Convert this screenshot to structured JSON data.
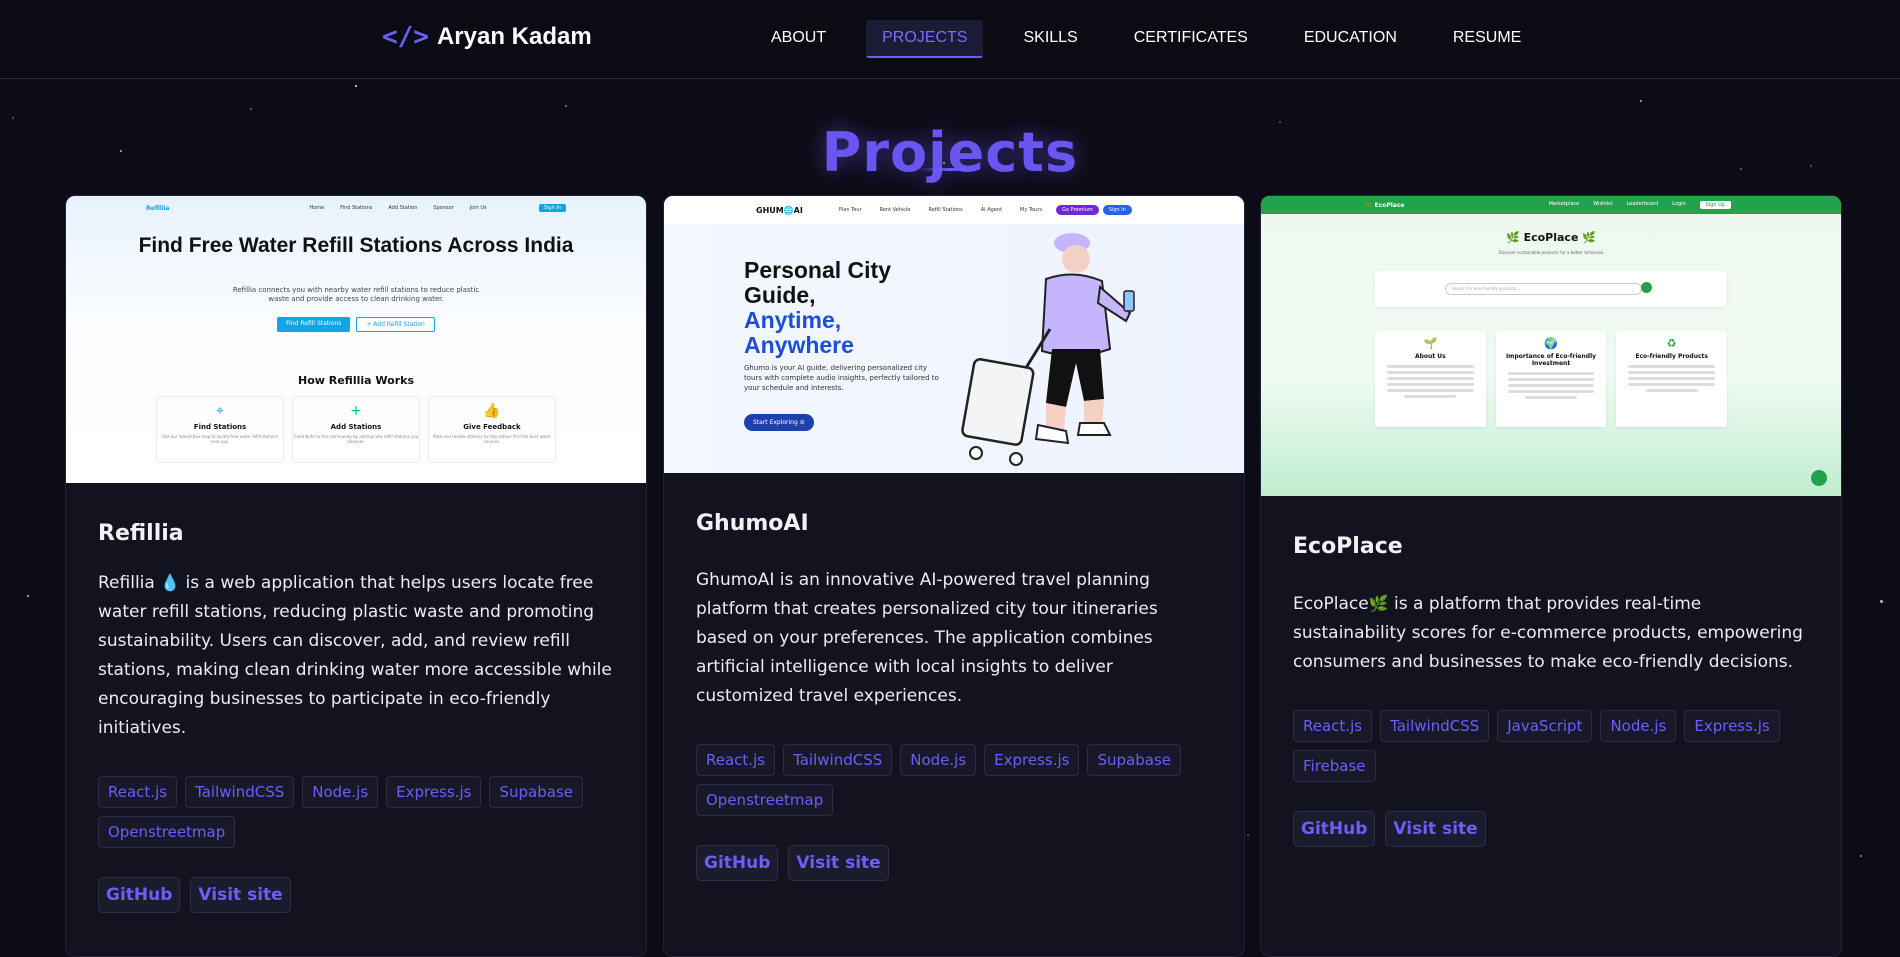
{
  "nav": {
    "logo_icon": "</>",
    "logo_text": "Aryan Kadam",
    "links": [
      "ABOUT",
      "PROJECTS",
      "SKILLS",
      "CERTIFICATES",
      "EDUCATION",
      "RESUME"
    ],
    "active": "PROJECTS"
  },
  "section": {
    "title": "Projects"
  },
  "projects": [
    {
      "title": "Refillia",
      "desc_lead": "Refillia",
      "desc_emoji": "💧",
      "desc_rest": " is a web application that helps users locate free water refill stations, reducing plastic waste and promoting sustainability. Users can discover, add, and review refill stations, making clean drinking water more accessible while encouraging businesses to participate in eco-friendly initiatives.",
      "tags": [
        "React.js",
        "TailwindCSS",
        "Node.js",
        "Express.js",
        "Supabase",
        "Openstreetmap"
      ],
      "links": [
        "GitHub",
        "Visit site"
      ],
      "screenshot": {
        "logo": "Refillia",
        "nav_items": [
          "Home",
          "Find Stations",
          "Add Station",
          "Sponsor",
          "Join Us"
        ],
        "nav_button": "Sign In",
        "heading": "Find Free Water Refill Stations Across India",
        "text": "Refillia connects you with nearby water refill stations to reduce plastic waste and provide access to clean drinking water.",
        "btn_primary": "Find Refill Stations",
        "btn_secondary": "+ Add Refill Station",
        "how_title": "How Refillia Works",
        "features": [
          {
            "icon": "⌖",
            "title": "Find Stations",
            "text": "Use our interactive map to locate free water refill stations near you."
          },
          {
            "icon": "+",
            "title": "Add Stations",
            "text": "Contribute to the community by adding new refill stations you discover."
          },
          {
            "icon": "👍",
            "title": "Give Feedback",
            "text": "Rate and review stations to help others find the best water sources."
          }
        ]
      }
    },
    {
      "title": "GhumoAI",
      "desc_lead": "GhumoAI",
      "desc_emoji": "",
      "desc_rest": " is an innovative AI-powered travel planning platform that creates personalized city tour itineraries based on your preferences. The application combines artificial intelligence with local insights to deliver customized travel experiences.",
      "tags": [
        "React.js",
        "TailwindCSS",
        "Node.js",
        "Express.js",
        "Supabase",
        "Openstreetmap"
      ],
      "links": [
        "GitHub",
        "Visit site"
      ],
      "screenshot": {
        "logo": "GHUM🌐AI",
        "nav_items": [
          "Plan Tour",
          "Rent Vehicle",
          "Refill Stations",
          "AI Agent",
          "My Tours"
        ],
        "pill1": "Go Premium",
        "pill2": "Sign In",
        "heading_1": "Personal City",
        "heading_2": "Guide,",
        "heading_3": "Anytime,",
        "heading_4": "Anywhere",
        "text": "Ghumo is your AI guide, delivering personalized city tours with complete audio insights, perfectly tailored to your schedule and interests.",
        "cta": "Start Exploring ⊘"
      }
    },
    {
      "title": "EcoPlace",
      "desc_lead": "EcoPlace",
      "desc_emoji": "🌿",
      "desc_rest": " is a platform that provides real-time sustainability scores for e-commerce products, empowering consumers and businesses to make eco-friendly decisions.",
      "tags": [
        "React.js",
        "TailwindCSS",
        "JavaScript",
        "Node.js",
        "Express.js",
        "Firebase"
      ],
      "links": [
        "GitHub",
        "Visit site"
      ],
      "screenshot": {
        "logo": "🌿 EcoPlace",
        "nav_items": [
          "Marketplace",
          "Wishlist",
          "Leaderboard",
          "Login"
        ],
        "nav_signup": "Sign Up",
        "heading": "🌿 EcoPlace 🌿",
        "subheading": "Discover sustainable products for a better tomorrow",
        "search_placeholder": "Search for eco-friendly products...",
        "cards": [
          {
            "icon": "🌱",
            "title": "About Us"
          },
          {
            "icon": "🌍",
            "title": "Importance of Eco-friendly Investment"
          },
          {
            "icon": "♻",
            "title": "Eco-friendly Products"
          }
        ]
      }
    }
  ]
}
